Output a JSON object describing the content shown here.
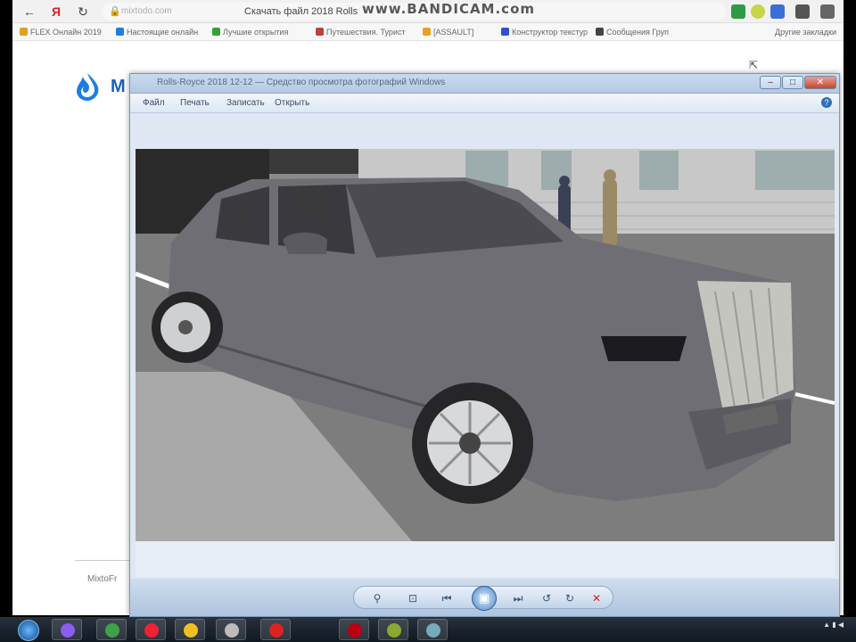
{
  "browser": {
    "nav": {
      "back": "←",
      "yandex": "Я",
      "reload": "↻"
    },
    "address_partial": "mixtodo.com",
    "tab_title": "Скачать файл 2018 Rolls",
    "watermark": "www.BANDICAM.com",
    "bookmarks": [
      {
        "label": "FLEX Онлайн 2019",
        "color": "#e0a020"
      },
      {
        "label": "Настоящие онлайн",
        "color": "#1e7de1"
      },
      {
        "label": "Лучшие открытия",
        "color": "#38a038"
      },
      {
        "label": "Путешествия. Турист",
        "color": "#c04040"
      },
      {
        "label": "[ASSAULT]",
        "color": "#e8a020"
      },
      {
        "label": "Конструктор текстур",
        "color": "#3050d0"
      },
      {
        "label": "Сообщения Груп",
        "color": "#444444"
      }
    ],
    "other_bookmarks": "Другие закладки"
  },
  "page": {
    "logo_text": "M",
    "footer_text": "MixtoFr"
  },
  "viewer": {
    "title": "Rolls-Royce 2018 12-12 — Средство просмотра фотографий Windows",
    "menu": [
      "Файл",
      "Печать",
      "Записать",
      "Открыть"
    ],
    "help": "?",
    "window_controls": {
      "min": "–",
      "max": "□",
      "close": "✕"
    }
  },
  "colors": {
    "accent": "#2f6fb8",
    "car_body": "#6e6e74",
    "grille": "#c5c5c0",
    "logo_flame": "#1e7de1"
  },
  "icons": [
    "back-icon",
    "yandex-icon",
    "reload-icon",
    "lock-icon",
    "bookmark-icon",
    "help-icon",
    "rotate-left-icon",
    "rotate-right-icon",
    "slideshow-icon",
    "delete-icon",
    "windows-start-icon"
  ]
}
